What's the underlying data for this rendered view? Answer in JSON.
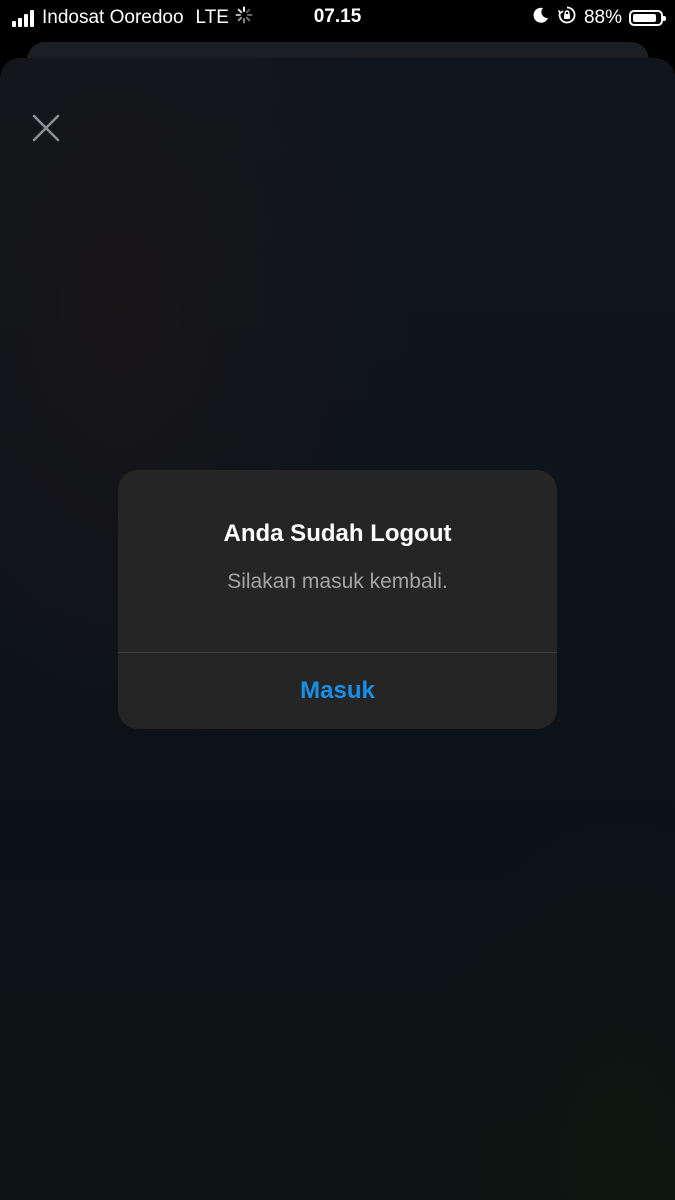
{
  "status_bar": {
    "carrier": "Indosat Ooredoo",
    "network": "LTE",
    "time": "07.15",
    "battery_percent": "88%",
    "battery_level": 0.88,
    "icons": [
      "signal-icon",
      "loading-spinner-icon",
      "moon-icon",
      "rotation-lock-icon",
      "battery-icon"
    ]
  },
  "alert": {
    "title": "Anda Sudah Logout",
    "message": "Silakan masuk kembali.",
    "action_label": "Masuk"
  },
  "colors": {
    "accent": "#1a8fe8",
    "alert_background": "#252525",
    "background": "#0d1318"
  }
}
